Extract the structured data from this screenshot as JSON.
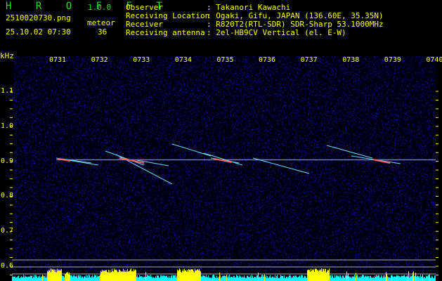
{
  "app": {
    "name": "H R O F F T",
    "version": "1.0.0"
  },
  "file": {
    "name": "2510020730.png",
    "datetime": "25.10.02 07:30"
  },
  "meteor": {
    "label": "meteor",
    "count": "36"
  },
  "info": [
    {
      "label": "Observer",
      "value": "Takanori Kawachi"
    },
    {
      "label": "Receiving Location",
      "value": "Ogaki, Gifu, JAPAN (136.60E, 35.35N)"
    },
    {
      "label": "Receiver",
      "value": "R820T2(RTL-SDR) SDR-Sharp 53.1000MHz"
    },
    {
      "label": "Receiving antenna",
      "value": "2el-HB9CV Vertical (el. E-W)"
    }
  ],
  "axis": {
    "unit": "kHz",
    "freq_ticks": [
      "1.1",
      "1.0",
      "0.9",
      "0.8",
      "0.7",
      "0.6"
    ],
    "time_ticks": [
      "0731",
      "0732",
      "0733",
      "0734",
      "0735",
      "0736",
      "0737",
      "0738",
      "0739",
      "0740"
    ]
  },
  "colors": {
    "title": "#22dd22",
    "text": "#ffff00",
    "noise": "#1a1aa0",
    "histogram_low": "#00ffff",
    "histogram_meteor": "#ffff00"
  }
}
